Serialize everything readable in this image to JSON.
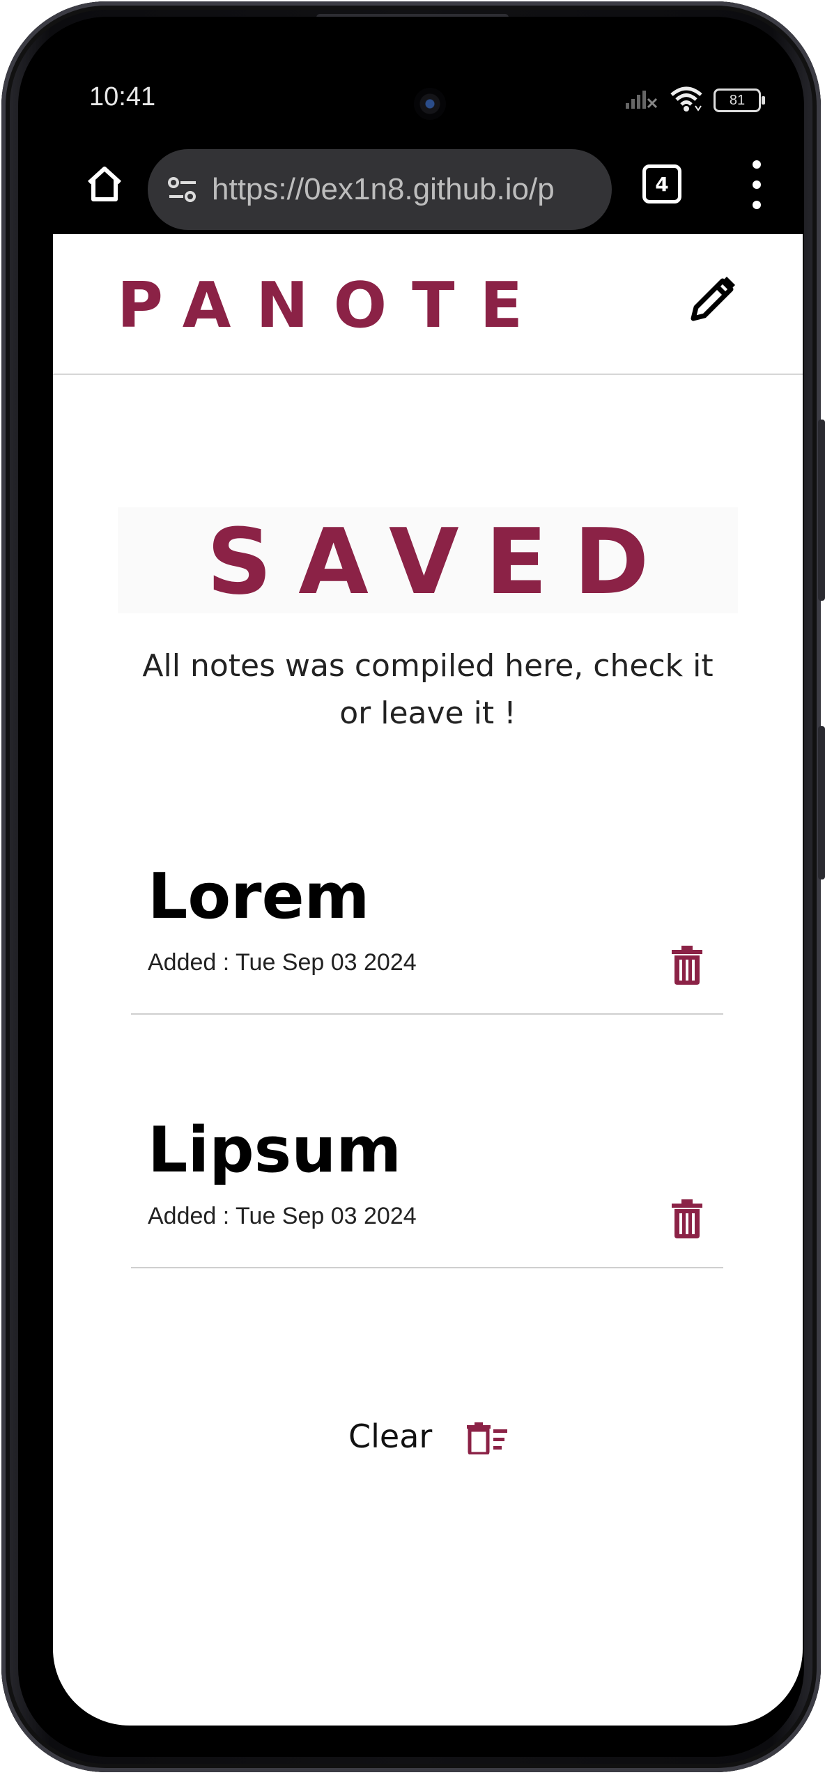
{
  "status_bar": {
    "time": "10:41",
    "battery": "81",
    "icons": [
      "camera-icon",
      "signal-icon",
      "wifi-icon",
      "battery-icon"
    ]
  },
  "browser": {
    "url": "https://0ex1n8.github.io/p",
    "tab_count": "4",
    "icons": [
      "home-icon",
      "site-settings-icon",
      "tabs-icon",
      "more-menu-icon"
    ]
  },
  "header": {
    "logo": "PANOTE",
    "edit_icon": "pencil-icon"
  },
  "hero": {
    "title": "SAVED",
    "subtitle": "All notes was compiled here, check it or leave it !"
  },
  "notes": [
    {
      "title": "Lorem",
      "date": "Added : Tue Sep 03 2024",
      "icon": "trash-icon"
    },
    {
      "title": "Lipsum",
      "date": "Added : Tue Sep 03 2024",
      "icon": "trash-icon"
    }
  ],
  "clear": {
    "label": "Clear",
    "icon": "clear-all-icon"
  },
  "colors": {
    "accent": "#8b2246",
    "text": "#000000",
    "divider": "#d6d6d6"
  }
}
